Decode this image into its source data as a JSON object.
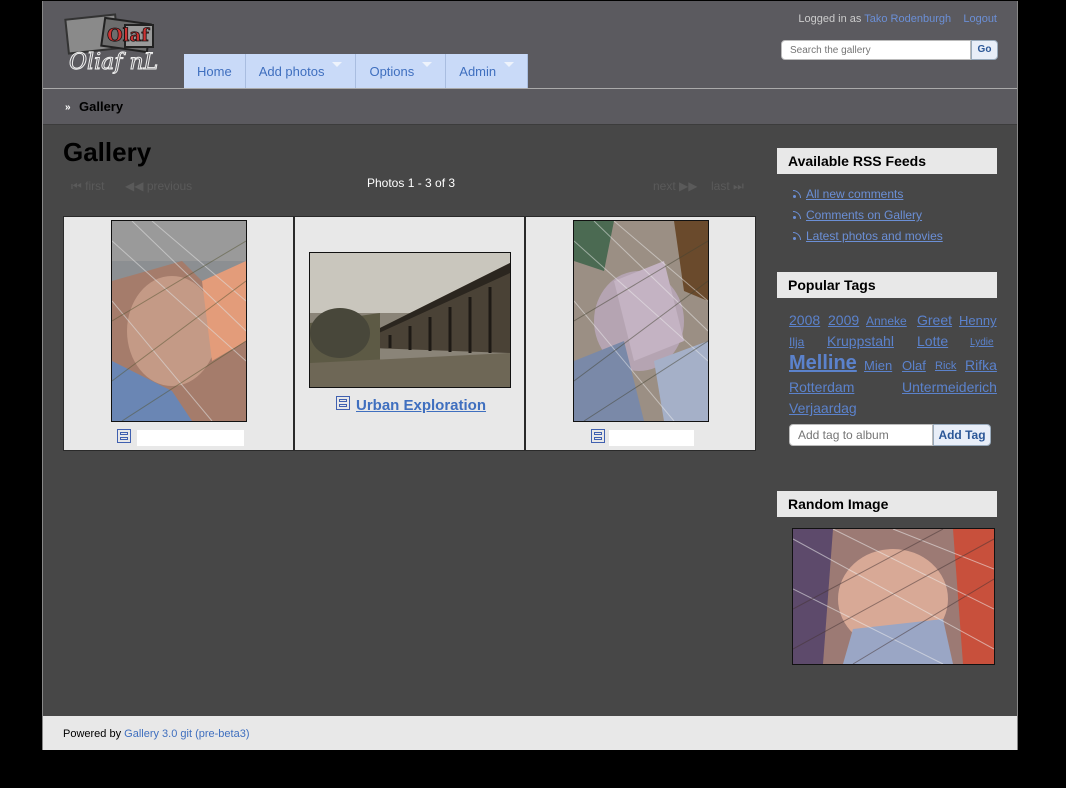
{
  "header": {
    "logo_text": "Oliaf nL",
    "login_prefix": "Logged in as",
    "user_name": "Tako Rodenburgh",
    "logout_label": "Logout",
    "search_placeholder": "Search the gallery",
    "search_button": "Go"
  },
  "nav": {
    "items": [
      {
        "label": "Home",
        "dropdown": false
      },
      {
        "label": "Add photos",
        "dropdown": true
      },
      {
        "label": "Options",
        "dropdown": true
      },
      {
        "label": "Admin",
        "dropdown": true
      }
    ]
  },
  "breadcrumb": {
    "current": "Gallery"
  },
  "main": {
    "title": "Gallery",
    "pager": {
      "first": "first",
      "previous": "previous",
      "count": "Photos 1 - 3 of 3",
      "next": "next",
      "last": "last"
    },
    "album_title": "Urban Exploration"
  },
  "sidebar": {
    "rss_heading": "Available RSS Feeds",
    "rss_items": [
      "All new comments",
      "Comments on Gallery",
      "Latest photos and movies"
    ],
    "tags_heading": "Popular Tags",
    "tags": [
      {
        "label": "2008"
      },
      {
        "label": "2009"
      },
      {
        "label": "Anneke"
      },
      {
        "label": "Greet"
      },
      {
        "label": "Henny"
      },
      {
        "label": "Ilja"
      },
      {
        "label": "Kruppstahl"
      },
      {
        "label": "Lotte"
      },
      {
        "label": "Lydie"
      },
      {
        "label": "Melline"
      },
      {
        "label": "Mien"
      },
      {
        "label": "Olaf"
      },
      {
        "label": "Rick"
      },
      {
        "label": "Rifka"
      },
      {
        "label": "Rotterdam"
      },
      {
        "label": "Untermeiderich"
      },
      {
        "label": "Verjaardag"
      }
    ],
    "tag_input_placeholder": "Add tag to album",
    "tag_button": "Add Tag",
    "random_heading": "Random Image"
  },
  "footer": {
    "prefix": "Powered by",
    "link": "Gallery 3.0 git (pre-beta3)"
  },
  "colors": {
    "accent": "#3f6fbf",
    "nav_bg": "#c9daf8",
    "page_bg": "#474747",
    "header_bg": "#5b5a5f"
  }
}
